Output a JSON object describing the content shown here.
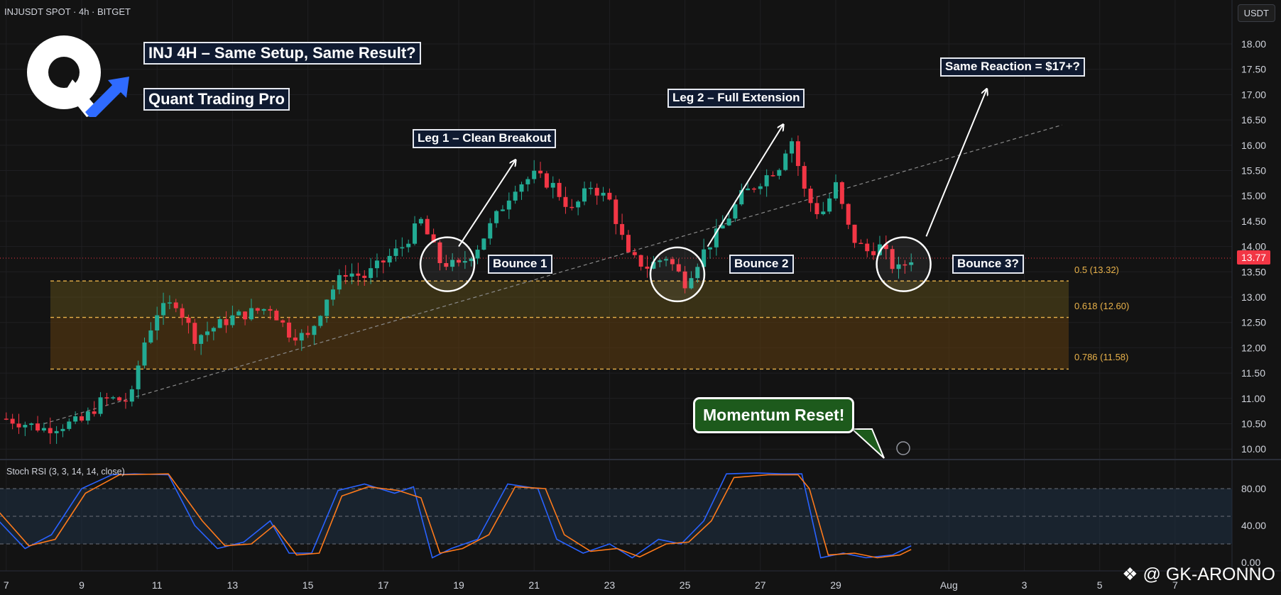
{
  "header": {
    "symbol": "INJUSDT SPOT · 4h · BITGET",
    "currency_button": "USDT"
  },
  "annotations": {
    "title": "INJ 4H – Same Setup, Same Result?",
    "subtitle": "Quant Trading Pro",
    "leg1": "Leg 1 – Clean Breakout",
    "leg2": "Leg 2 – Full Extension",
    "target": "Same Reaction = $17+?",
    "bounce1": "Bounce 1",
    "bounce2": "Bounce 2",
    "bounce3": "Bounce 3?",
    "momentum": "Momentum Reset!"
  },
  "indicator": {
    "title": "Stoch RSI (3, 3, 14, 14, close)"
  },
  "watermark": "@ GK-ARONNO",
  "colors": {
    "up": "#22ab94",
    "down": "#f23645",
    "k_line": "#2962ff",
    "d_line": "#ff7a1a",
    "fib_line": "#e9b24a",
    "background": "#131313",
    "logo_accent": "#2f6bff"
  },
  "chart_data": [
    {
      "type": "candlestick",
      "title": "INJUSDT SPOT · 4h · BITGET",
      "y_ticks": [
        "18.00",
        "17.50",
        "17.00",
        "16.50",
        "16.00",
        "15.50",
        "15.00",
        "14.50",
        "14.00",
        "13.50",
        "13.00",
        "12.50",
        "12.00",
        "11.50",
        "11.00",
        "10.50",
        "10.00"
      ],
      "x_ticks": [
        "7",
        "9",
        "11",
        "13",
        "15",
        "17",
        "19",
        "21",
        "23",
        "25",
        "27",
        "29",
        "Aug",
        "3",
        "5",
        "7"
      ],
      "ylim": [
        9.9,
        18.3
      ],
      "current_price": "13.77",
      "fib_levels": [
        {
          "label": "0.5 (13.32)",
          "value": 13.32
        },
        {
          "label": "0.618 (12.60)",
          "value": 12.6
        },
        {
          "label": "0.786 (11.58)",
          "value": 11.58
        }
      ],
      "trendline": {
        "from": {
          "date": "Jul 8",
          "price": 10.5
        },
        "to": {
          "date": "Aug 4",
          "price": 16.4
        }
      },
      "close_path": [
        {
          "date": "Jul 7.0",
          "close": 10.6
        },
        {
          "date": "Jul 8.0",
          "close": 10.4
        },
        {
          "date": "Jul 9.0",
          "close": 10.55
        },
        {
          "date": "Jul 9.6",
          "close": 11.0
        },
        {
          "date": "Jul 10.3",
          "close": 10.95
        },
        {
          "date": "Jul 10.6",
          "close": 12.0
        },
        {
          "date": "Jul 11.0",
          "close": 12.7
        },
        {
          "date": "Jul 11.5",
          "close": 12.9
        },
        {
          "date": "Jul 12.0",
          "close": 12.2
        },
        {
          "date": "Jul 13.0",
          "close": 12.6
        },
        {
          "date": "Jul 14.0",
          "close": 12.8
        },
        {
          "date": "Jul 14.5",
          "close": 12.3
        },
        {
          "date": "Jul 15.0",
          "close": 12.2
        },
        {
          "date": "Jul 15.5",
          "close": 13.0
        },
        {
          "date": "Jul 16.0",
          "close": 13.5
        },
        {
          "date": "Jul 16.5",
          "close": 13.4
        },
        {
          "date": "Jul 17.0",
          "close": 13.7
        },
        {
          "date": "Jul 17.5",
          "close": 14.0
        },
        {
          "date": "Jul 18.0",
          "close": 14.5
        },
        {
          "date": "Jul 18.5",
          "close": 13.7
        },
        {
          "date": "Jul 19.0",
          "close": 13.6
        },
        {
          "date": "Jul 19.5",
          "close": 14.0
        },
        {
          "date": "Jul 20.0",
          "close": 14.6
        },
        {
          "date": "Jul 20.5",
          "close": 15.2
        },
        {
          "date": "Jul 21.0",
          "close": 15.4
        },
        {
          "date": "Jul 21.5",
          "close": 15.2
        },
        {
          "date": "Jul 22.0",
          "close": 14.7
        },
        {
          "date": "Jul 22.5",
          "close": 15.2
        },
        {
          "date": "Jul 23.0",
          "close": 14.9
        },
        {
          "date": "Jul 23.5",
          "close": 13.8
        },
        {
          "date": "Jul 24.0",
          "close": 13.6
        },
        {
          "date": "Jul 24.5",
          "close": 13.8
        },
        {
          "date": "Jul 25.0",
          "close": 13.3
        },
        {
          "date": "Jul 25.5",
          "close": 13.9
        },
        {
          "date": "Jul 26.0",
          "close": 14.4
        },
        {
          "date": "Jul 26.5",
          "close": 15.0
        },
        {
          "date": "Jul 27.0",
          "close": 15.3
        },
        {
          "date": "Jul 27.5",
          "close": 15.6
        },
        {
          "date": "Jul 27.8",
          "close": 16.2
        },
        {
          "date": "Jul 28.2",
          "close": 15.0
        },
        {
          "date": "Jul 28.6",
          "close": 14.6
        },
        {
          "date": "Jul 29.0",
          "close": 15.2
        },
        {
          "date": "Jul 29.4",
          "close": 14.2
        },
        {
          "date": "Jul 29.8",
          "close": 13.9
        },
        {
          "date": "Jul 30.2",
          "close": 14.0
        },
        {
          "date": "Jul 30.6",
          "close": 13.5
        },
        {
          "date": "Jul 31.0",
          "close": 13.77
        }
      ],
      "bounces": [
        {
          "label": "Bounce 1",
          "date": "Jul 18.7",
          "price": 13.65
        },
        {
          "label": "Bounce 2",
          "date": "Jul 24.8",
          "price": 13.45
        },
        {
          "label": "Bounce 3?",
          "date": "Jul 30.8",
          "price": 13.65
        }
      ],
      "arrows": [
        {
          "label": "Leg 1 – Clean Breakout",
          "from": {
            "date": "Jul 19.0",
            "price": 14.0
          },
          "to": {
            "date": "Jul 20.5",
            "price": 15.7
          }
        },
        {
          "label": "Leg 2 – Full Extension",
          "from": {
            "date": "Jul 25.6",
            "price": 14.0
          },
          "to": {
            "date": "Jul 27.6",
            "price": 16.4
          }
        },
        {
          "label": "Same Reaction = $17+?",
          "from": {
            "date": "Jul 31.4",
            "price": 14.2
          },
          "to": {
            "date": "Aug 2.0",
            "price": 17.1
          }
        }
      ]
    },
    {
      "type": "line",
      "title": "Stoch RSI (3, 3, 14, 14, close)",
      "y_ticks": [
        "80.00",
        "40.00",
        "0.00"
      ],
      "ylim": [
        0,
        100
      ],
      "bands": [
        80,
        20
      ],
      "series": [
        {
          "name": "K",
          "points": [
            {
              "date": "Jul 6.8",
              "value": 45
            },
            {
              "date": "Jul 7.5",
              "value": 15
            },
            {
              "date": "Jul 8.2",
              "value": 30
            },
            {
              "date": "Jul 9.0",
              "value": 80
            },
            {
              "date": "Jul 9.8",
              "value": 95
            },
            {
              "date": "Jul 10.4",
              "value": 96
            },
            {
              "date": "Jul 11.3",
              "value": 95
            },
            {
              "date": "Jul 12.0",
              "value": 40
            },
            {
              "date": "Jul 12.6",
              "value": 15
            },
            {
              "date": "Jul 13.3",
              "value": 22
            },
            {
              "date": "Jul 14.0",
              "value": 45
            },
            {
              "date": "Jul 14.5",
              "value": 10
            },
            {
              "date": "Jul 15.1",
              "value": 10
            },
            {
              "date": "Jul 15.8",
              "value": 78
            },
            {
              "date": "Jul 16.5",
              "value": 85
            },
            {
              "date": "Jul 17.3",
              "value": 75
            },
            {
              "date": "Jul 17.8",
              "value": 82
            },
            {
              "date": "Jul 18.3",
              "value": 5
            },
            {
              "date": "Jul 18.8",
              "value": 15
            },
            {
              "date": "Jul 19.5",
              "value": 25
            },
            {
              "date": "Jul 20.3",
              "value": 85
            },
            {
              "date": "Jul 21.1",
              "value": 80
            },
            {
              "date": "Jul 21.6",
              "value": 25
            },
            {
              "date": "Jul 22.3",
              "value": 10
            },
            {
              "date": "Jul 23.0",
              "value": 20
            },
            {
              "date": "Jul 23.6",
              "value": 5
            },
            {
              "date": "Jul 24.3",
              "value": 25
            },
            {
              "date": "Jul 24.9",
              "value": 20
            },
            {
              "date": "Jul 25.5",
              "value": 45
            },
            {
              "date": "Jul 26.1",
              "value": 96
            },
            {
              "date": "Jul 26.9",
              "value": 97
            },
            {
              "date": "Jul 27.6",
              "value": 96
            },
            {
              "date": "Jul 28.1",
              "value": 96
            },
            {
              "date": "Jul 28.6",
              "value": 5
            },
            {
              "date": "Jul 29.2",
              "value": 10
            },
            {
              "date": "Jul 29.8",
              "value": 5
            },
            {
              "date": "Jul 30.5",
              "value": 8
            },
            {
              "date": "Jul 31.0",
              "value": 18
            }
          ]
        },
        {
          "name": "D",
          "points": [
            {
              "date": "Jul 6.8",
              "value": 55
            },
            {
              "date": "Jul 7.6",
              "value": 18
            },
            {
              "date": "Jul 8.3",
              "value": 25
            },
            {
              "date": "Jul 9.1",
              "value": 75
            },
            {
              "date": "Jul 10.0",
              "value": 95
            },
            {
              "date": "Jul 11.3",
              "value": 96
            },
            {
              "date": "Jul 12.2",
              "value": 45
            },
            {
              "date": "Jul 12.8",
              "value": 18
            },
            {
              "date": "Jul 13.5",
              "value": 20
            },
            {
              "date": "Jul 14.1",
              "value": 40
            },
            {
              "date": "Jul 14.7",
              "value": 8
            },
            {
              "date": "Jul 15.3",
              "value": 10
            },
            {
              "date": "Jul 15.9",
              "value": 72
            },
            {
              "date": "Jul 16.6",
              "value": 82
            },
            {
              "date": "Jul 17.4",
              "value": 78
            },
            {
              "date": "Jul 18.0",
              "value": 70
            },
            {
              "date": "Jul 18.5",
              "value": 10
            },
            {
              "date": "Jul 19.1",
              "value": 15
            },
            {
              "date": "Jul 19.8",
              "value": 30
            },
            {
              "date": "Jul 20.5",
              "value": 82
            },
            {
              "date": "Jul 21.3",
              "value": 80
            },
            {
              "date": "Jul 21.8",
              "value": 30
            },
            {
              "date": "Jul 22.5",
              "value": 12
            },
            {
              "date": "Jul 23.2",
              "value": 15
            },
            {
              "date": "Jul 23.8",
              "value": 6
            },
            {
              "date": "Jul 24.5",
              "value": 20
            },
            {
              "date": "Jul 25.1",
              "value": 22
            },
            {
              "date": "Jul 25.7",
              "value": 45
            },
            {
              "date": "Jul 26.3",
              "value": 92
            },
            {
              "date": "Jul 27.2",
              "value": 95
            },
            {
              "date": "Jul 28.0",
              "value": 95
            },
            {
              "date": "Jul 28.3",
              "value": 80
            },
            {
              "date": "Jul 28.8",
              "value": 8
            },
            {
              "date": "Jul 29.5",
              "value": 10
            },
            {
              "date": "Jul 30.1",
              "value": 5
            },
            {
              "date": "Jul 30.7",
              "value": 8
            },
            {
              "date": "Jul 31.0",
              "value": 14
            }
          ]
        }
      ]
    }
  ]
}
